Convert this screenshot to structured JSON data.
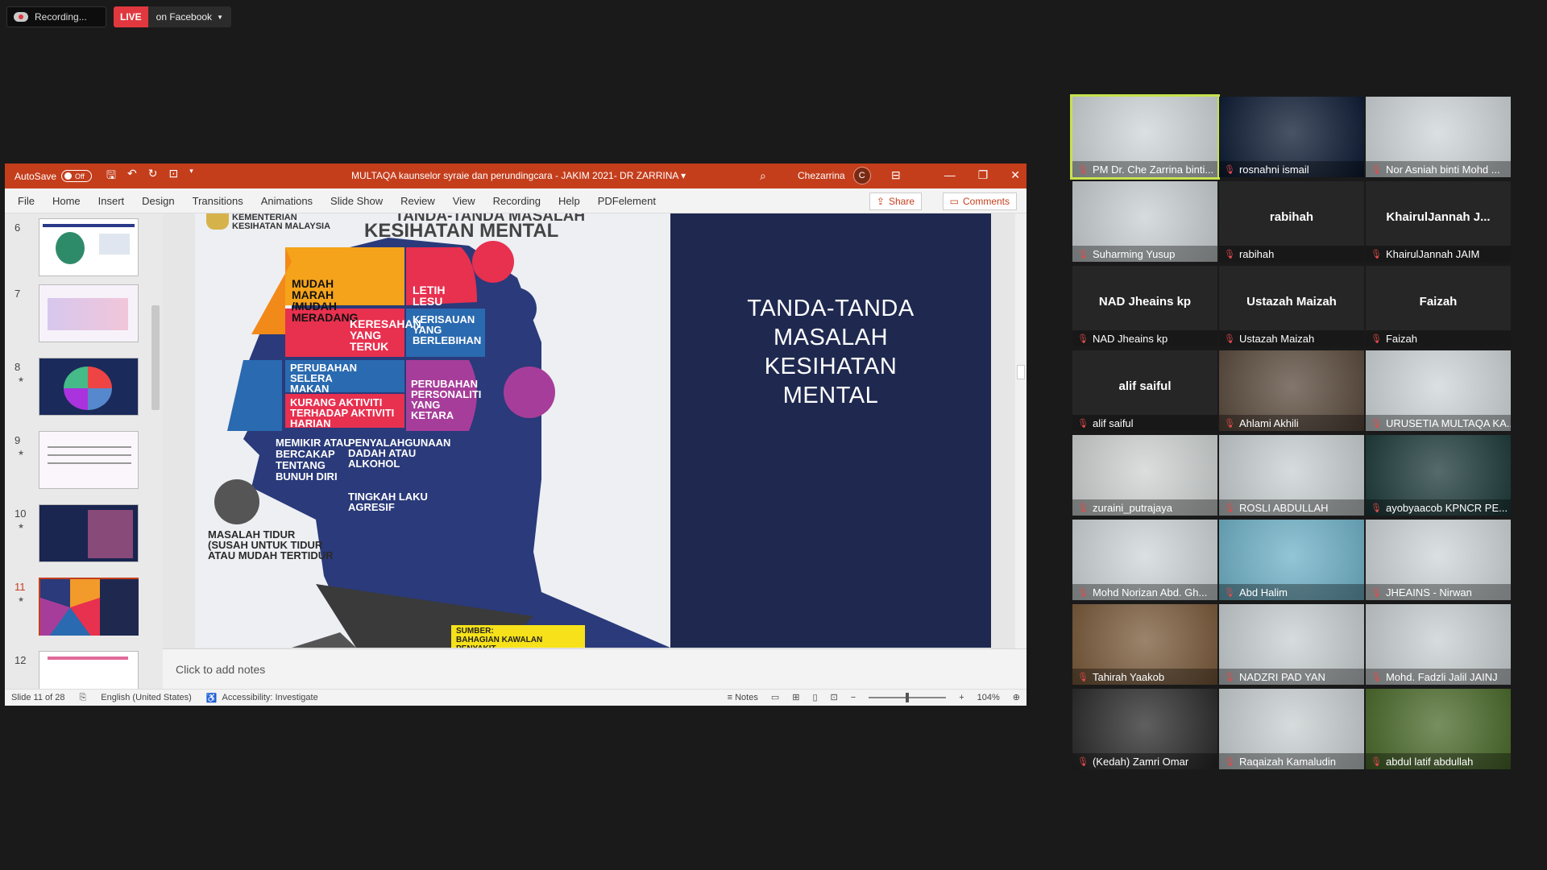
{
  "recording": {
    "label": "Recording...",
    "live": "LIVE",
    "destination": "on Facebook"
  },
  "ppt": {
    "autosave_label": "AutoSave",
    "autosave_state": "Off",
    "doc_title": "MULTAQA kaunselor syraie dan perundingcara - JAKIM 2021- DR ZARRINA",
    "user_name": "Chezarrina",
    "user_initial": "C",
    "menu": [
      "File",
      "Home",
      "Insert",
      "Design",
      "Transitions",
      "Animations",
      "Slide Show",
      "Review",
      "View",
      "Recording",
      "Help",
      "PDFelement"
    ],
    "share_label": "Share",
    "comments_label": "Comments",
    "thumbnails": [
      {
        "num": "6",
        "star": ""
      },
      {
        "num": "7",
        "star": ""
      },
      {
        "num": "8",
        "star": "★"
      },
      {
        "num": "9",
        "star": "★"
      },
      {
        "num": "10",
        "star": "★"
      },
      {
        "num": "11",
        "star": "★"
      },
      {
        "num": "12",
        "star": ""
      }
    ],
    "notes_placeholder": "Click to add notes",
    "status": {
      "slide": "Slide 11 of 28",
      "language": "English (United States)",
      "accessibility": "Accessibility: Investigate",
      "notes": "Notes",
      "zoom": "104%"
    }
  },
  "slide": {
    "org_line1": "KEMENTERIAN",
    "org_line2": "KESIHATAN MALAYSIA",
    "header_top": "TANDA-TANDA MASALAH",
    "header_main": "KESIHATAN MENTAL",
    "right_title": [
      "TANDA-TANDA",
      "MASALAH",
      "KESIHATAN",
      "MENTAL"
    ],
    "items": {
      "mudah_marah": "MUDAH MARAH /MUDAH MERADANG",
      "letih_lesu": "LETIH LESU",
      "keresahan": "KERESAHAN YANG TERUK",
      "kerisauan": "KERISAUAN YANG BERLEBIHAN",
      "selera": "PERUBAHAN SELERA MAKAN",
      "kurang_aktiviti": "KURANG AKTIVITI TERHADAP AKTIVITI HARIAN",
      "personaliti": "PERUBAHAN PERSONALITI YANG KETARA",
      "bunuh_diri": "MEMIKIR ATAU BERCAKAP TENTANG BUNUH DIRI",
      "dadah": "PENYALAHGUNAAN DADAH ATAU ALKOHOL",
      "agresif": "TINGKAH LAKU AGRESIF",
      "tidur": "MASALAH TIDUR (SUSAH UNTUK TIDUR ATAU MUDAH TERTIDUR"
    },
    "source_label": "SUMBER:",
    "source_value": "BAHAGIAN KAWALAN PENYAKIT"
  },
  "participants": [
    {
      "name": "PM Dr. Che Zarrina binti...",
      "big": "",
      "bg": "#cfd6d8",
      "active": true
    },
    {
      "name": "rosnahni ismail",
      "big": "",
      "bg": "#0c1a33",
      "active": false
    },
    {
      "name": "Nor Asniah binti Mohd ...",
      "big": "",
      "bg": "#cfd6d8",
      "active": false
    },
    {
      "name": "Suharming Yusup",
      "big": "",
      "bg": "#c9d0d2",
      "active": false
    },
    {
      "name": "rabihah",
      "big": "rabihah",
      "bg": "#262626",
      "active": false
    },
    {
      "name": "KhairulJannah JAIM",
      "big": "KhairulJannah J...",
      "bg": "#262626",
      "active": false
    },
    {
      "name": "NAD Jheains kp",
      "big": "NAD Jheains kp",
      "bg": "#262626",
      "active": false
    },
    {
      "name": "Ustazah Maizah",
      "big": "Ustazah Maizah",
      "bg": "#262626",
      "active": false
    },
    {
      "name": "Faizah",
      "big": "Faizah",
      "bg": "#262626",
      "active": false
    },
    {
      "name": "alif saiful",
      "big": "alif saiful",
      "bg": "#262626",
      "active": false
    },
    {
      "name": "Ahlami Akhili",
      "big": "",
      "bg": "#5a4a3c",
      "active": false
    },
    {
      "name": "URUSETIA MULTAQA KA...",
      "big": "",
      "bg": "#cfd6d8",
      "active": false
    },
    {
      "name": "zuraini_putrajaya",
      "big": "",
      "bg": "#cfd3d2",
      "active": false
    },
    {
      "name": "ROSLI ABDULLAH",
      "big": "",
      "bg": "#c9d0d2",
      "active": false
    },
    {
      "name": "ayobyaacob KPNCR PE...",
      "big": "",
      "bg": "#1d3a3a",
      "active": false
    },
    {
      "name": "Mohd Norizan Abd. Gh...",
      "big": "",
      "bg": "#cfd6d8",
      "active": false
    },
    {
      "name": "Abd Halim",
      "big": "",
      "bg": "#6fb2c8",
      "active": false
    },
    {
      "name": "JHEAINS - Nirwan",
      "big": "",
      "bg": "#cfd6d8",
      "active": false
    },
    {
      "name": "Tahirah Yaakob",
      "big": "",
      "bg": "#7a5a3a",
      "active": false
    },
    {
      "name": "NADZRI PAD YAN",
      "big": "",
      "bg": "#c9d0d2",
      "active": false
    },
    {
      "name": "Mohd. Fadzli Jalil JAINJ",
      "big": "",
      "bg": "#c9d0d2",
      "active": false
    },
    {
      "name": "(Kedah) Zamri Omar",
      "big": "",
      "bg": "#2a2a2a",
      "active": false
    },
    {
      "name": "Raqaizah Kamaludin",
      "big": "",
      "bg": "#c9d0d2",
      "active": false
    },
    {
      "name": "abdul latif abdullah",
      "big": "",
      "bg": "#4a6a2a",
      "active": false
    }
  ],
  "colors": {
    "accent": "#c43e1c",
    "active_speaker": "#c6e24e",
    "slide_navy": "#1f2950"
  }
}
